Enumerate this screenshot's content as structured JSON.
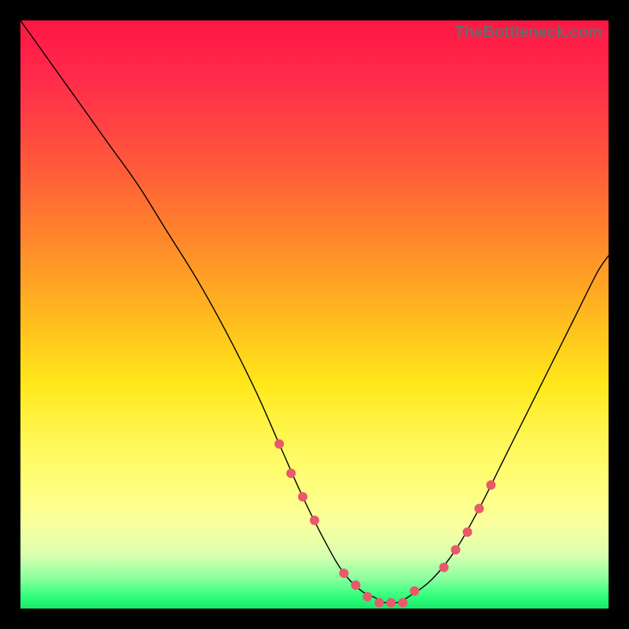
{
  "watermark": "TheBottleneck.com",
  "chart_data": {
    "type": "line",
    "title": "",
    "xlabel": "",
    "ylabel": "",
    "xlim": [
      0,
      100
    ],
    "ylim": [
      0,
      100
    ],
    "grid": false,
    "legend": false,
    "background_gradient": {
      "top": "#ff1744",
      "middle": "#ffe81a",
      "bottom": "#19e86a"
    },
    "series": [
      {
        "name": "bottleneck-curve",
        "color": "#000000",
        "x": [
          0,
          5,
          10,
          15,
          20,
          25,
          30,
          35,
          40,
          44,
          48,
          52,
          55,
          58,
          60,
          62,
          64,
          66,
          70,
          74,
          78,
          82,
          86,
          90,
          94,
          98,
          100
        ],
        "y": [
          100,
          93,
          86,
          79,
          72,
          64,
          56,
          47,
          37,
          28,
          19,
          11,
          6,
          3,
          2,
          1,
          1,
          2,
          5,
          10,
          17,
          25,
          33,
          41,
          49,
          57,
          60
        ]
      }
    ],
    "marker_points": {
      "comment": "dots along the curve in the 'good' (green/yellow-green) band; y here is the same curve y-value",
      "x": [
        44,
        46,
        48,
        50,
        55,
        57,
        59,
        61,
        63,
        65,
        67,
        72,
        74,
        76,
        78,
        80
      ],
      "y": [
        28,
        23,
        19,
        15,
        6,
        4,
        2,
        1,
        1,
        1,
        3,
        7,
        10,
        13,
        17,
        21
      ]
    }
  }
}
